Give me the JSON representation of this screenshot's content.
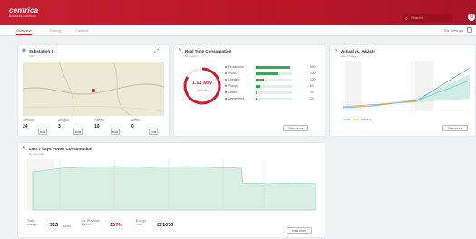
{
  "brand": {
    "logo": "centrica",
    "sub": "Business Solutions"
  },
  "search": {
    "placeholder": "Search"
  },
  "user": {
    "initial": "U"
  },
  "tabs": [
    {
      "label": "Overview"
    },
    {
      "label": "Energy"
    },
    {
      "label": "Comfort"
    }
  ],
  "tab_settings": "Tile Settings",
  "site": {
    "title": "Substation 1",
    "subtitle": "Site",
    "stats": [
      {
        "label": "Sensors",
        "value": "24",
        "unit": "total"
      },
      {
        "label": "Bridges",
        "value": "3",
        "unit": "total"
      },
      {
        "label": "Panels",
        "value": "10",
        "unit": "total"
      },
      {
        "label": "Alerts",
        "value": "0",
        "unit": "total"
      }
    ]
  },
  "realtime": {
    "title": "Real Time Consumption",
    "subtitle": "By Category",
    "total_value": "1.01 MW",
    "total_label": "Total site",
    "rows": [
      {
        "label": "Production",
        "fraction": 0.95,
        "value": "530"
      },
      {
        "label": "HVAC",
        "fraction": 0.62,
        "value": "220"
      },
      {
        "label": "Lighting",
        "fraction": 0.22,
        "value": "120"
      },
      {
        "label": "Pumps",
        "fraction": 0.12,
        "value": "60"
      },
      {
        "label": "Office",
        "fraction": 0.06,
        "value": "40"
      },
      {
        "label": "Unmetered",
        "fraction": 0.03,
        "value": "30"
      }
    ],
    "view_label": "View more"
  },
  "actual": {
    "title": "Actual vs. Awaste",
    "subtitle": "Last 30 days",
    "legend": [
      "Actual",
      "Target",
      "Baseline"
    ],
    "view_label": "View more"
  },
  "last7": {
    "title": "Last 7 days Power Consumption",
    "subtitle": "By Site total",
    "foot": [
      {
        "label": "Total energy",
        "value": "352",
        "unit": "MWh"
      },
      {
        "label": "Vs. Previous Period",
        "value": "127%",
        "unit": ""
      },
      {
        "label": "Energy cost",
        "value": "£51079",
        "unit": ""
      }
    ],
    "view_label": "View more"
  },
  "colors": {
    "brand": "#c51f32",
    "green": "#3aa458",
    "teal": "#7fc7b1"
  }
}
